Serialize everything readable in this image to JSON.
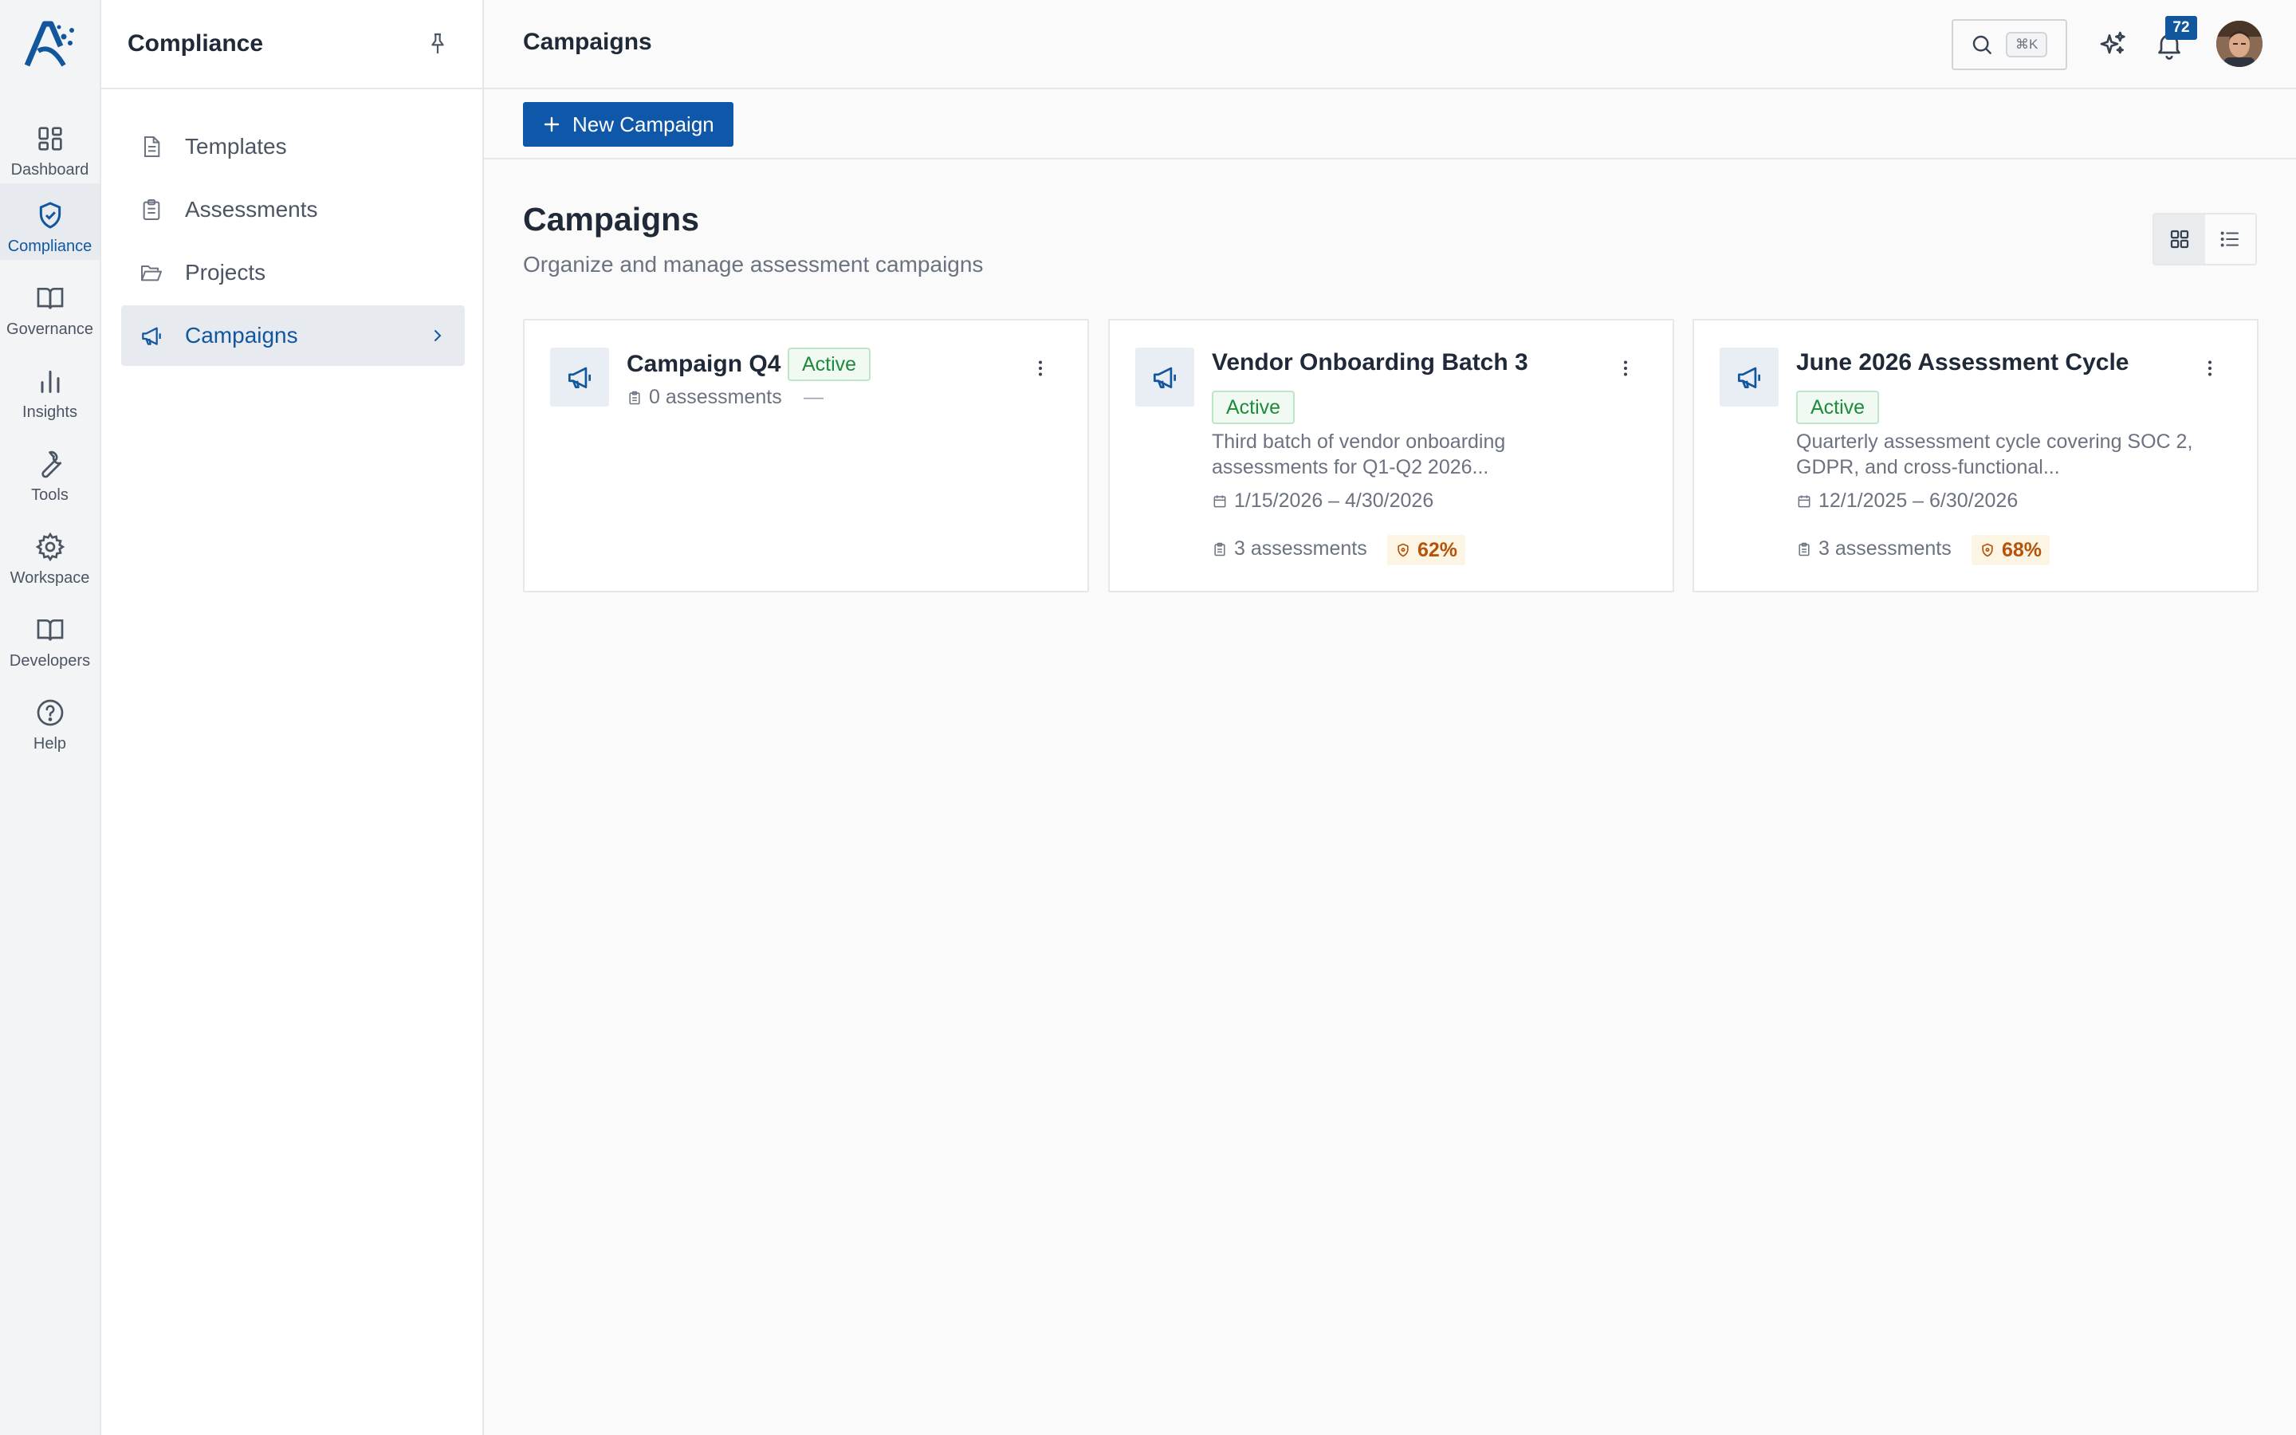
{
  "rail": {
    "items": [
      {
        "label": "Dashboard",
        "icon": "dashboard-icon"
      },
      {
        "label": "Compliance",
        "icon": "shield-check-icon"
      },
      {
        "label": "Governance",
        "icon": "book-icon"
      },
      {
        "label": "Insights",
        "icon": "bar-chart-icon"
      },
      {
        "label": "Tools",
        "icon": "wrench-icon"
      },
      {
        "label": "Workspace",
        "icon": "gear-icon"
      },
      {
        "label": "Developers",
        "icon": "book-open-icon"
      },
      {
        "label": "Help",
        "icon": "help-circle-icon"
      }
    ],
    "active": "Compliance"
  },
  "subnav": {
    "title": "Compliance",
    "items": [
      {
        "label": "Templates",
        "icon": "file-text-icon"
      },
      {
        "label": "Assessments",
        "icon": "clipboard-icon"
      },
      {
        "label": "Projects",
        "icon": "folder-open-icon"
      },
      {
        "label": "Campaigns",
        "icon": "megaphone-icon"
      }
    ],
    "active": "Campaigns"
  },
  "topbar": {
    "title": "Campaigns",
    "search_shortcut": "⌘K",
    "notification_count": "72"
  },
  "actions": {
    "new_campaign_label": "New Campaign"
  },
  "page": {
    "title": "Campaigns",
    "subtitle": "Organize and manage assessment campaigns",
    "view_mode": "grid"
  },
  "campaigns": [
    {
      "name": "Campaign Q4",
      "status": "Active",
      "description": "",
      "date_range": "",
      "assessments": "0 assessments",
      "score": "—"
    },
    {
      "name": "Vendor Onboarding Batch 3",
      "status": "Active",
      "description": "Third batch of vendor onboarding assessments for Q1-Q2 2026...",
      "date_range": "1/15/2026 – 4/30/2026",
      "assessments": "3 assessments",
      "score": "62%"
    },
    {
      "name": "June 2026 Assessment Cycle",
      "status": "Active",
      "description": "Quarterly assessment cycle covering SOC 2, GDPR, and cross-functional...",
      "date_range": "12/1/2025 – 6/30/2026",
      "assessments": "3 assessments",
      "score": "68%"
    }
  ],
  "colors": {
    "accent": "#0f57a8",
    "active_badge_text": "#1f8a3b",
    "score_text": "#b45309"
  }
}
